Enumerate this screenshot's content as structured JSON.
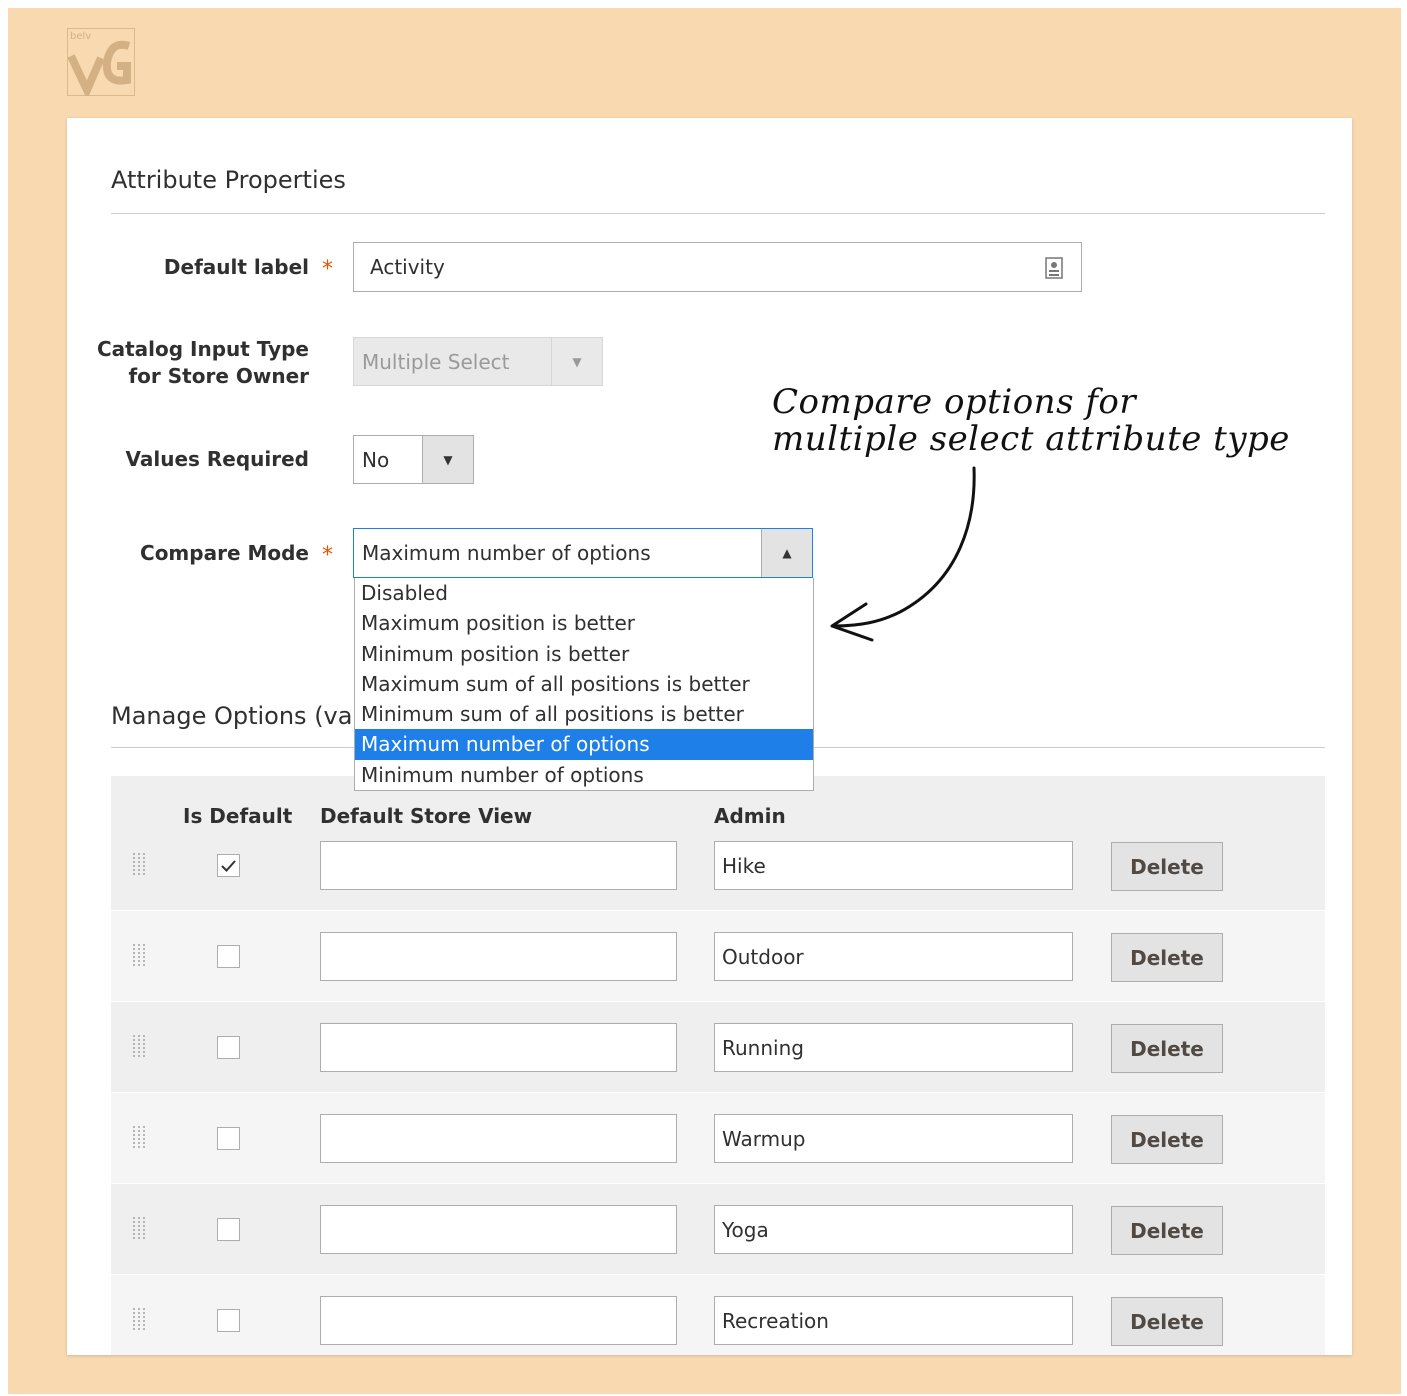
{
  "logo": {
    "text": "belv",
    "icon": "belvg-logo-icon"
  },
  "attribute_properties": {
    "title": "Attribute Properties",
    "default_label": {
      "label": "Default label",
      "required_mark": "*",
      "value": "Activity",
      "icon": "contact-card-icon"
    },
    "catalog_input_type": {
      "label_line1": "Catalog Input Type",
      "label_line2": "for Store Owner",
      "value": "Multiple Select",
      "disabled": true
    },
    "values_required": {
      "label": "Values Required",
      "value": "No"
    },
    "compare_mode": {
      "label": "Compare Mode",
      "required_mark": "*",
      "value": "Maximum number of options",
      "options": [
        "Disabled",
        "Maximum position is better",
        "Minimum position is better",
        "Maximum sum of all positions is better",
        "Minimum sum of all positions is better",
        "Maximum number of options",
        "Minimum number of options"
      ],
      "selected_index": 5
    }
  },
  "annotation": {
    "line1": "Compare options for",
    "line2": "multiple select attribute type"
  },
  "manage_options": {
    "title": "Manage Options (va",
    "columns": {
      "is_default": "Is Default",
      "default_store_view": "Default Store View",
      "admin": "Admin"
    },
    "delete_label": "Delete",
    "rows": [
      {
        "checked": true,
        "store_view": "",
        "admin": "Hike"
      },
      {
        "checked": false,
        "store_view": "",
        "admin": "Outdoor"
      },
      {
        "checked": false,
        "store_view": "",
        "admin": "Running"
      },
      {
        "checked": false,
        "store_view": "",
        "admin": "Warmup"
      },
      {
        "checked": false,
        "store_view": "",
        "admin": "Yoga"
      },
      {
        "checked": false,
        "store_view": "",
        "admin": "Recreation"
      }
    ]
  },
  "colors": {
    "background": "#f8d9b0",
    "required": "#eb5202",
    "selected_option": "#1e7fe8"
  }
}
